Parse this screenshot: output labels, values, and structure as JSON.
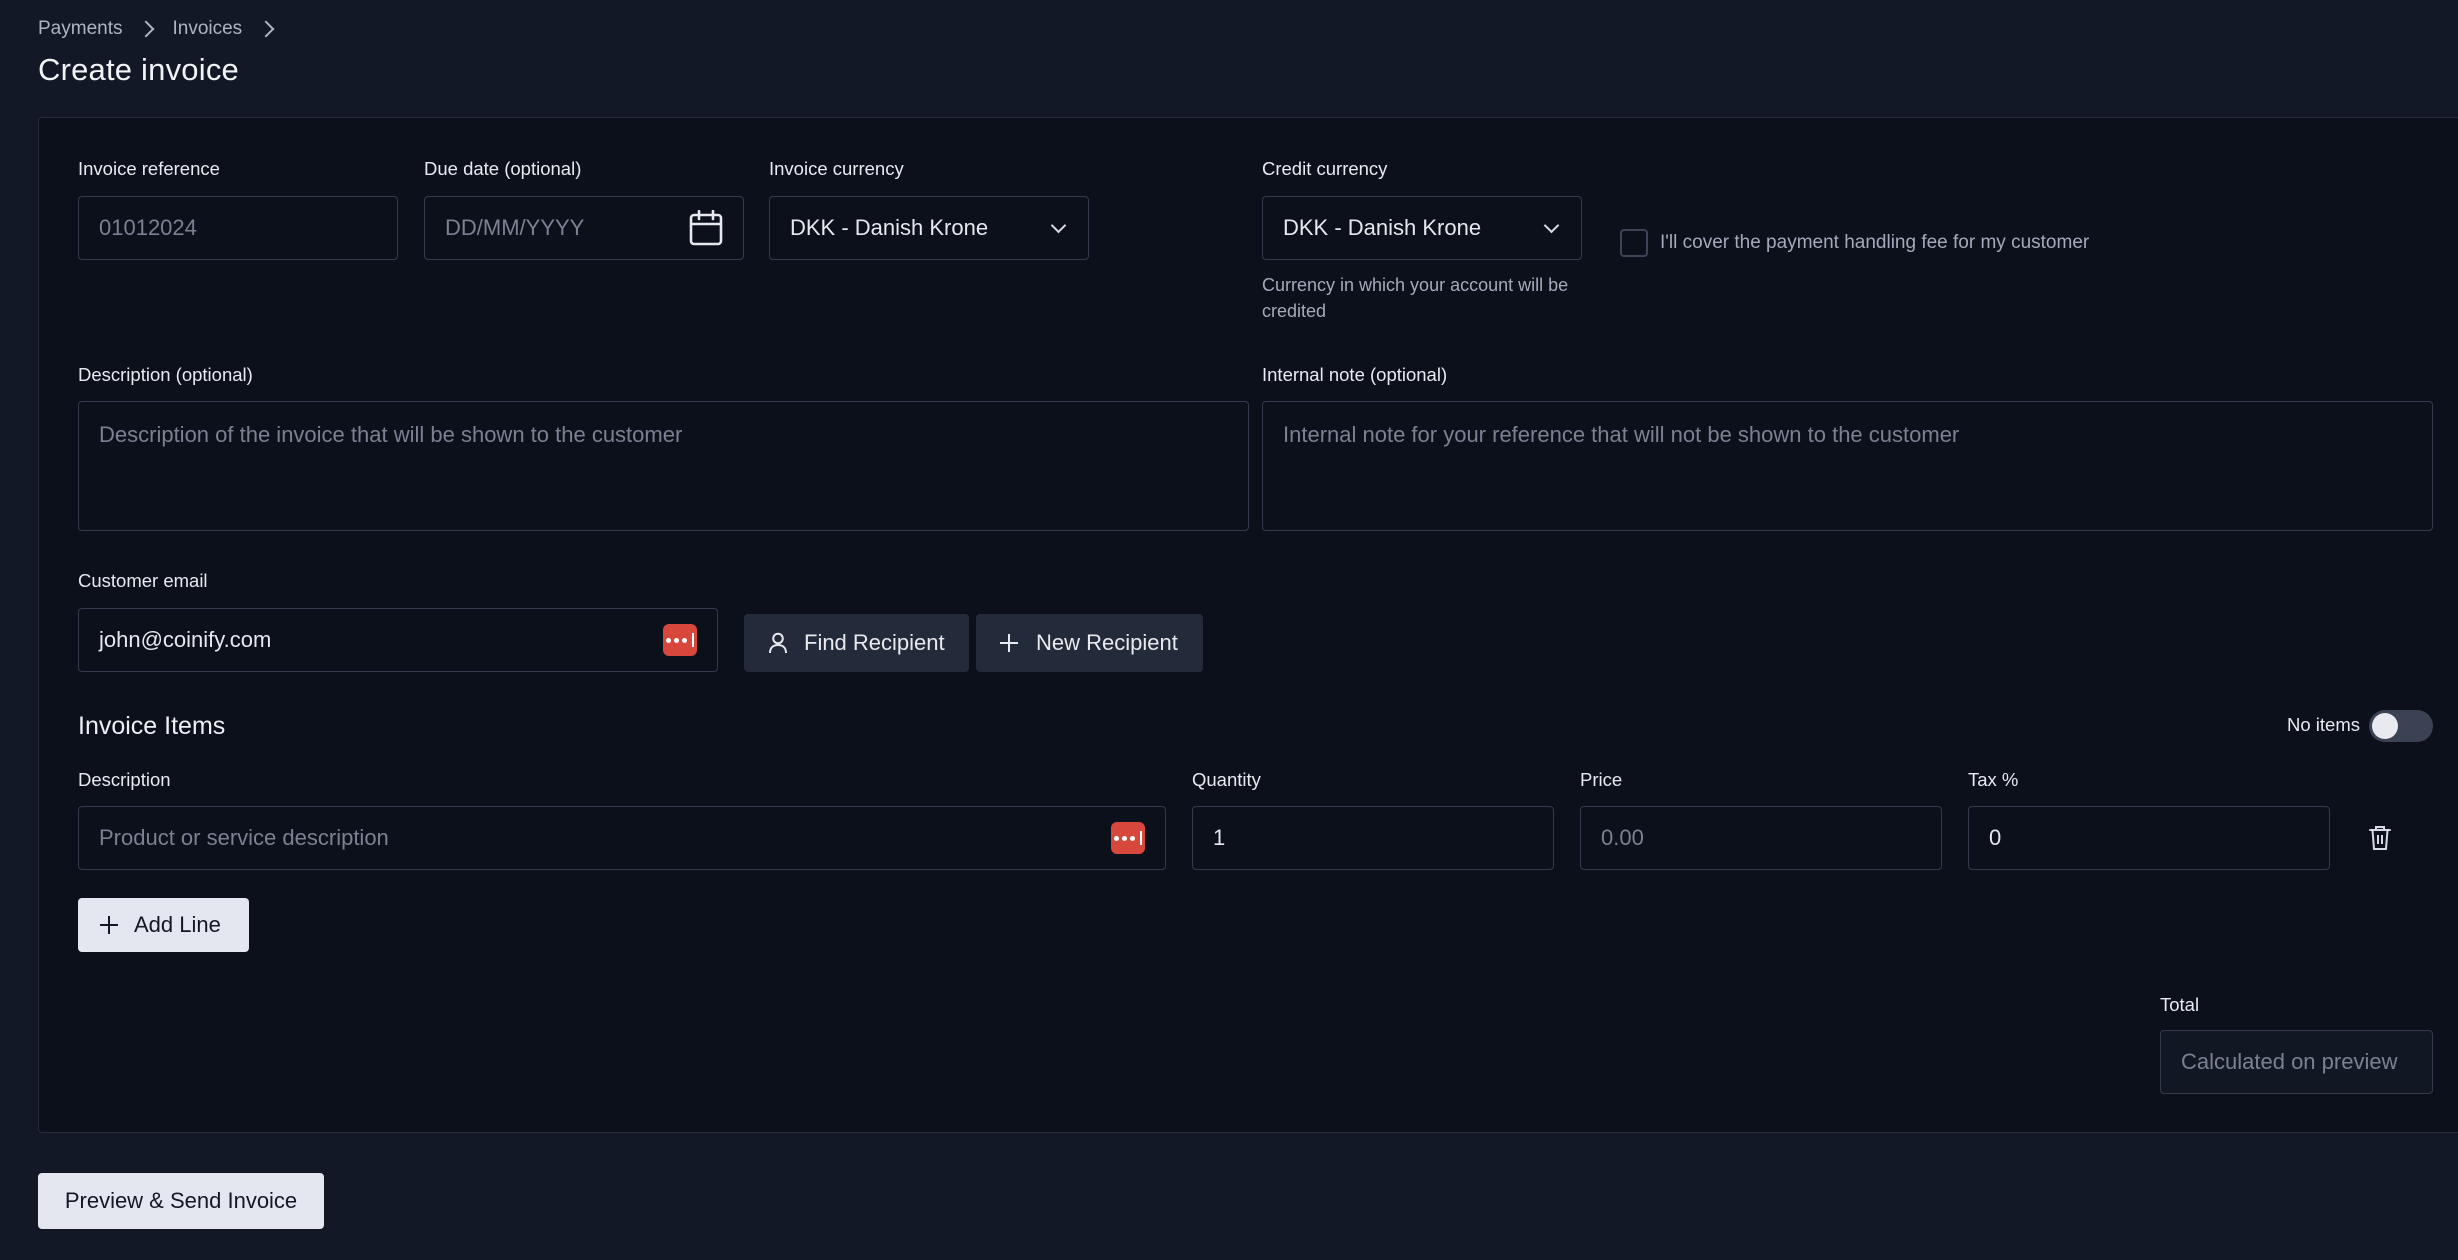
{
  "breadcrumb": {
    "items": [
      "Payments",
      "Invoices"
    ]
  },
  "page": {
    "title": "Create invoice"
  },
  "form": {
    "invoice_reference": {
      "label": "Invoice reference",
      "placeholder": "01012024"
    },
    "due_date": {
      "label": "Due date (optional)",
      "placeholder": "DD/MM/YYYY"
    },
    "invoice_currency": {
      "label": "Invoice currency",
      "value": "DKK - Danish Krone"
    },
    "credit_currency": {
      "label": "Credit currency",
      "value": "DKK - Danish Krone",
      "help": "Currency in which your account will be credited"
    },
    "cover_fee": {
      "label": "I'll cover the payment handling fee for my customer",
      "checked": false
    },
    "description": {
      "label": "Description (optional)",
      "placeholder": "Description of the invoice that will be shown to the customer"
    },
    "internal_note": {
      "label": "Internal note (optional)",
      "placeholder": "Internal note for your reference that will not be shown to the customer"
    },
    "customer_email": {
      "label": "Customer email",
      "value": "john@coinify.com"
    },
    "find_recipient_label": "Find Recipient",
    "new_recipient_label": "New Recipient"
  },
  "items": {
    "title": "Invoice Items",
    "no_items_label": "No items",
    "no_items_on": false,
    "columns": {
      "description": "Description",
      "quantity": "Quantity",
      "price": "Price",
      "tax": "Tax %"
    },
    "rows": [
      {
        "description_placeholder": "Product or service description",
        "quantity": "1",
        "price_placeholder": "0.00",
        "tax": "0"
      }
    ],
    "add_line_label": "Add Line",
    "total_label": "Total",
    "total_placeholder": "Calculated on preview"
  },
  "footer": {
    "submit_label": "Preview & Send Invoice"
  },
  "icons": {
    "password_manager": "password-manager-icon",
    "calendar": "calendar-icon",
    "chevron": "chevron-down-icon",
    "person": "person-icon",
    "plus": "plus-icon",
    "trash": "trash-icon"
  },
  "colors": {
    "background": "#131826",
    "panel": "#0c101a",
    "password_manager_badge": "#d8473c",
    "light_button": "#e4e7ef"
  }
}
